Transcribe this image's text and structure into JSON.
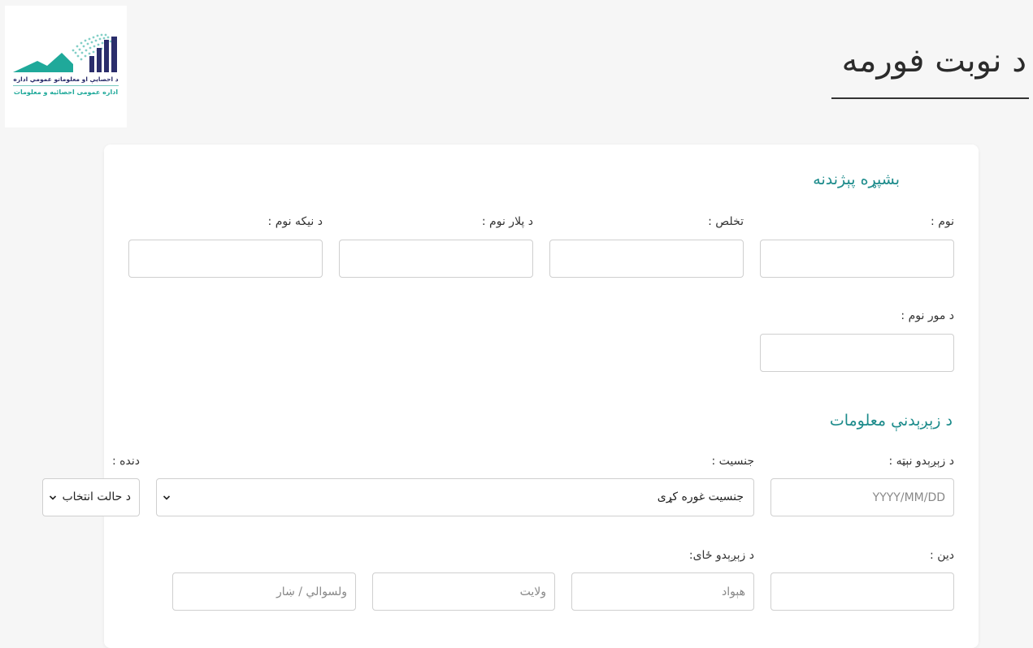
{
  "logo": {
    "line1": "د احصایې او معلوماتو عمومي اداره",
    "line2": "اداره عمومی احصائیه و معلومات",
    "colors": {
      "navy": "#2a2d6b",
      "teal": "#1fa99a"
    }
  },
  "page_title": "د نوبت فورمه",
  "sections": {
    "applicant": {
      "title": "بشپړه پېژندنه",
      "labels": {
        "first_name": "نوم :",
        "last_name": "تخلص :",
        "father_name": "د پلار نوم :",
        "grandfather_name": "د نیکه نوم :",
        "mother_name": "د مور نوم :"
      }
    },
    "birth": {
      "title": "د زېږېدنې معلومات",
      "labels": {
        "birth_date": "د زېږېدو نېټه :",
        "gender": "جنسیت :",
        "marital": "دنده :",
        "religion": "دین :",
        "birth_place": "د زېږېدو ځای:"
      },
      "placeholders": {
        "birth_date": "YYYY/MM/DD",
        "country": "هېواد",
        "province": "ولایت",
        "district": "ولسوالي / ښار"
      },
      "selects": {
        "gender_value": "جنسیت غوره کړی",
        "status_value": "د حالت انتخاب"
      }
    }
  },
  "colors": {
    "accent": "#1c8b8b",
    "background": "#f6f6f6",
    "card": "#ffffff",
    "border": "#cfcfcf"
  }
}
